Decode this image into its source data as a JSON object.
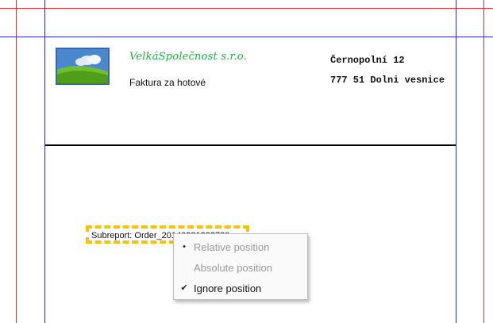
{
  "company": {
    "name": "VelkáSpolečnost s.r.o.",
    "invoice_type": "Faktura za hotové",
    "address_street": "Černopolní 12",
    "address_city": "777 51 Dolni vesnice"
  },
  "subreport": {
    "label": "Subreport: Order_20140331233730"
  },
  "context_menu": {
    "items": [
      {
        "label": "Relative position",
        "mark": "•",
        "enabled": false
      },
      {
        "label": "Absolute position",
        "mark": "",
        "enabled": false
      },
      {
        "label": "Ignore position",
        "mark": "✔",
        "enabled": true
      }
    ]
  },
  "colors": {
    "guide_margin": "#e8323a",
    "guide_band": "#2a2ae0",
    "company_name": "#16b43b",
    "selection_dash": "#f5c400"
  }
}
